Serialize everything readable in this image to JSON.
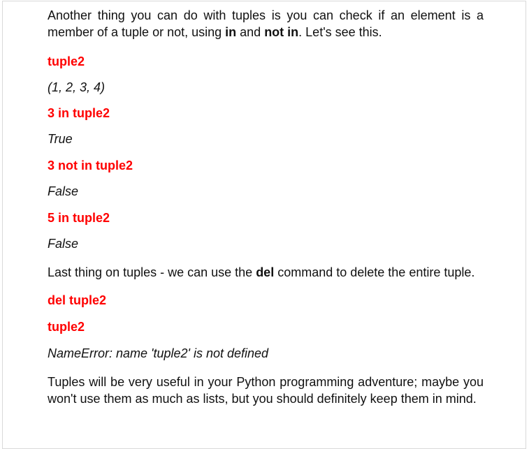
{
  "intro": {
    "text1": "Another thing you can do with tuples is you can check if an element is a member of a tuple or not, using ",
    "kw1": "in",
    "text2": " and ",
    "kw2": "not in",
    "text3": ". Let's see this."
  },
  "examples": [
    {
      "code": "tuple2",
      "output": "(1, 2, 3, 4)"
    },
    {
      "code": "3 in tuple2",
      "output": "True"
    },
    {
      "code": "3 not in tuple2",
      "output": "False"
    },
    {
      "code": "5 in tuple2",
      "output": "False"
    }
  ],
  "del_para": {
    "text1": "Last thing on tuples - we can use the ",
    "kw": "del",
    "text2": " command to delete the entire tuple."
  },
  "del_example": {
    "code1": "del tuple2",
    "code2": "tuple2",
    "output": "NameError: name 'tuple2' is not defined"
  },
  "closing": "Tuples will be very useful in your Python programming adventure; maybe you won't use them as much as lists, but you should definitely keep them in mind."
}
